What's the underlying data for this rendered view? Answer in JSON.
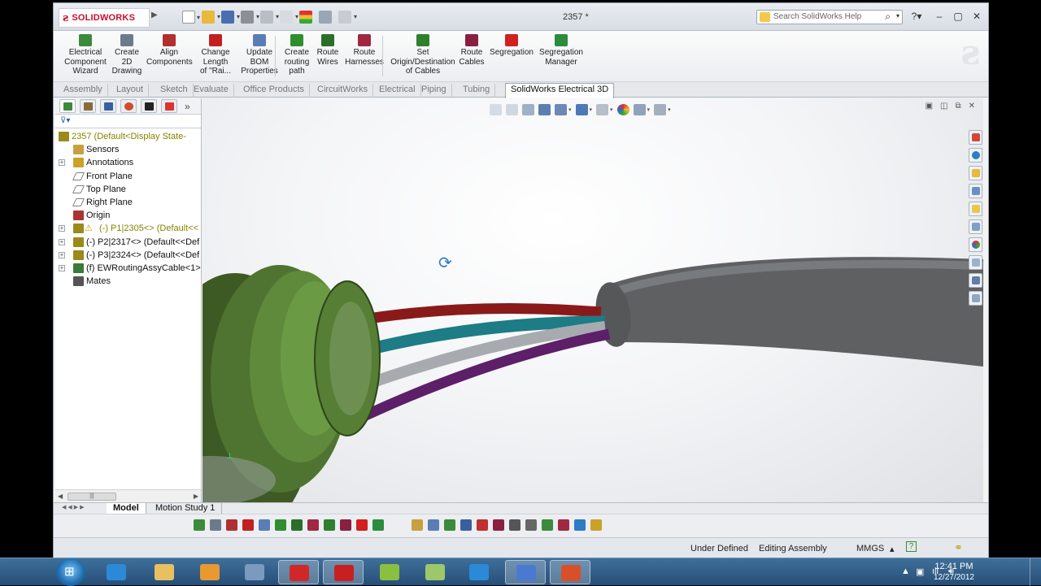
{
  "app": {
    "name": "SOLIDWORKS",
    "doc_title": "2357 *"
  },
  "search": {
    "placeholder": "Search SolidWorks Help"
  },
  "commands": [
    {
      "label": "Electrical\nComponent\nWizard",
      "icon": "component-wizard-icon",
      "color": "#3c8a3c"
    },
    {
      "label": "Create\n2D\nDrawing",
      "icon": "drawing-icon",
      "color": "#6b7b8c"
    },
    {
      "label": "Align\nComponents",
      "icon": "align-icon",
      "color": "#b03030"
    },
    {
      "label": "Change\nLength\nof \"Rai...",
      "icon": "change-length-icon",
      "color": "#c02020"
    },
    {
      "label": "Update\nBOM\nProperties",
      "icon": "bom-icon",
      "color": "#5a7db5"
    },
    {
      "label": "Create\nrouting\npath",
      "icon": "routing-path-icon",
      "color": "#2f8f2f"
    },
    {
      "label": "Route\nWires",
      "icon": "route-wires-icon",
      "color": "#2a6e2a"
    },
    {
      "label": "Route\nHarnesses",
      "icon": "route-harness-icon",
      "color": "#a02840"
    },
    {
      "label": "Set\nOrigin/Destination\nof Cables",
      "icon": "origin-destination-icon",
      "color": "#2f7f2f"
    },
    {
      "label": "Route\nCables",
      "icon": "route-cables-icon",
      "color": "#8a2040"
    },
    {
      "label": "Segregation",
      "icon": "segregation-icon",
      "color": "#d02020"
    },
    {
      "label": "Segregation\nManager",
      "icon": "segregation-manager-icon",
      "color": "#2c8c3c"
    }
  ],
  "tabs": [
    "Assembly",
    "Layout",
    "Sketch",
    "Evaluate",
    "Office Products",
    "CircuitWorks",
    "Electrical",
    "Piping",
    "Tubing",
    "SolidWorks Electrical 3D"
  ],
  "active_tab": "SolidWorks Electrical 3D",
  "tree": [
    {
      "label": "2357  (Default<Display State-",
      "icon": "assembly-icon",
      "color": "#8a8200",
      "exp": false,
      "indent": 0,
      "warn": false
    },
    {
      "label": "Sensors",
      "icon": "sensors-icon",
      "exp": false,
      "indent": 1
    },
    {
      "label": "Annotations",
      "icon": "annotations-icon",
      "exp": true,
      "indent": 1
    },
    {
      "label": "Front Plane",
      "icon": "plane-icon",
      "exp": false,
      "indent": 1
    },
    {
      "label": "Top Plane",
      "icon": "plane-icon",
      "exp": false,
      "indent": 1
    },
    {
      "label": "Right Plane",
      "icon": "plane-icon",
      "exp": false,
      "indent": 1
    },
    {
      "label": "Origin",
      "icon": "origin-icon",
      "exp": false,
      "indent": 1
    },
    {
      "label": "(-) P1|2305<> (Default<<",
      "icon": "part-icon",
      "color": "#8a8200",
      "exp": true,
      "indent": 1,
      "warn": true
    },
    {
      "label": "(-) P2|2317<> (Default<<Def",
      "icon": "part-icon",
      "exp": true,
      "indent": 1,
      "warn": false
    },
    {
      "label": "(-) P3|2324<> (Default<<Def",
      "icon": "part-icon",
      "exp": true,
      "indent": 1,
      "warn": false
    },
    {
      "label": "(f) EWRoutingAssyCable<1>",
      "icon": "routing-assy-icon",
      "exp": true,
      "indent": 1,
      "warn": false
    },
    {
      "label": "Mates",
      "icon": "mates-icon",
      "exp": false,
      "indent": 1
    }
  ],
  "bottom_tabs": [
    "Model",
    "Motion Study 1"
  ],
  "active_bottom_tab": "Model",
  "status": {
    "state": "Under Defined",
    "mode": "Editing Assembly",
    "units": "MMGS"
  },
  "clock": {
    "time": "12:41 PM",
    "date": "12/27/2012"
  },
  "taskbar_apps": [
    "internet-explorer",
    "file-explorer",
    "outlook",
    "virtualbox",
    "solidworks-electrical",
    "solidworks",
    "app-green",
    "app-leaf",
    "app-blue-x",
    "app-flower",
    "powerpoint"
  ]
}
